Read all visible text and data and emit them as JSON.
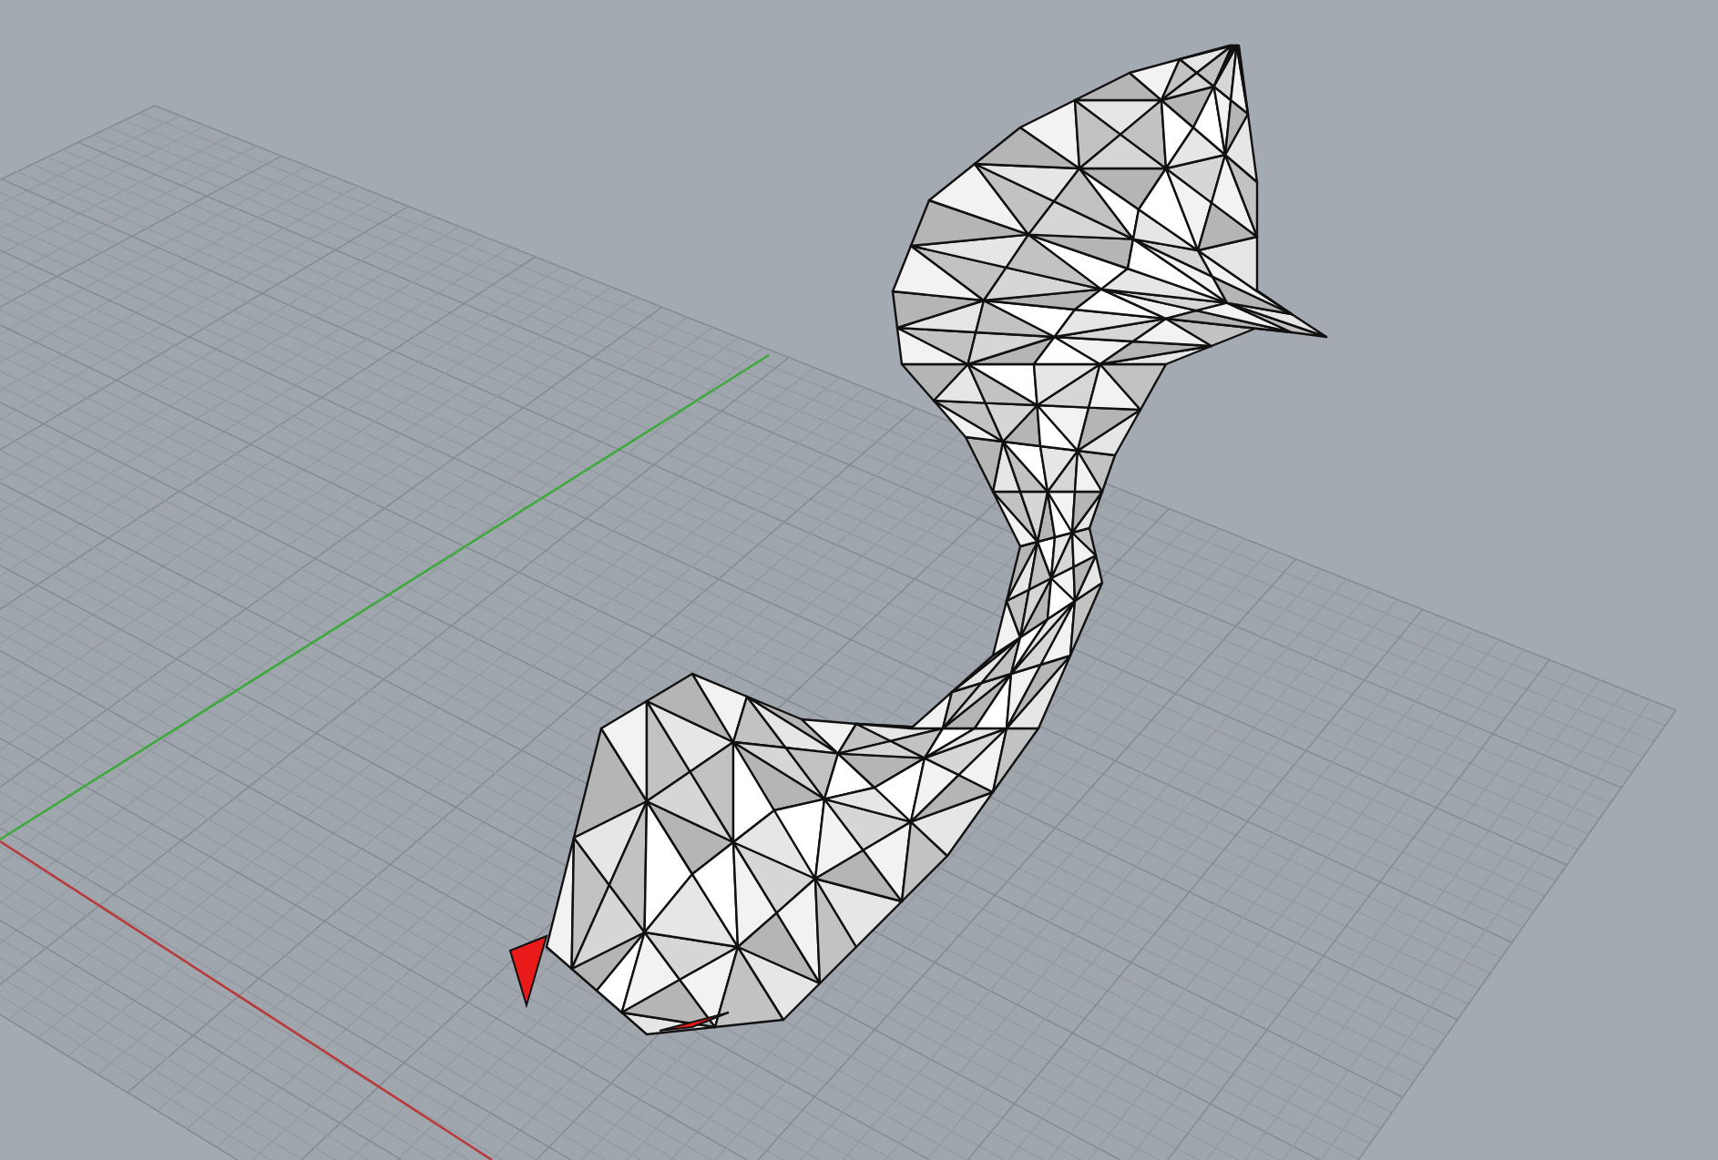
{
  "viewport": {
    "grid_visible": true,
    "axes_visible": true,
    "mesh_visible": true
  }
}
